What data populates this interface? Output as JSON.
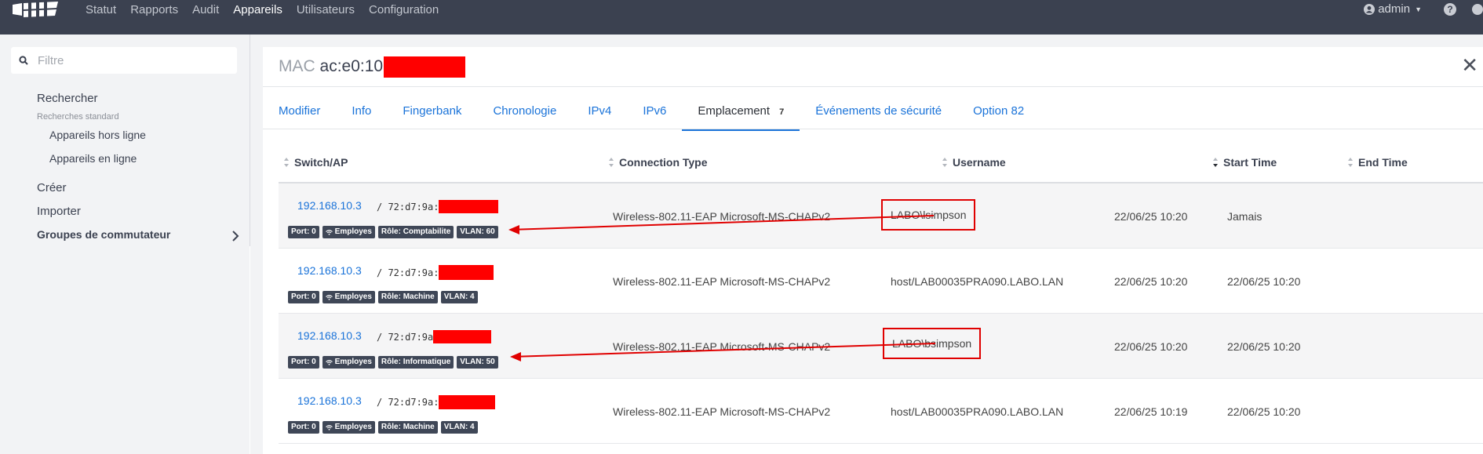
{
  "nav": {
    "items": [
      "Statut",
      "Rapports",
      "Audit",
      "Appareils",
      "Utilisateurs",
      "Configuration"
    ],
    "active": "Appareils",
    "user": "admin"
  },
  "sidebar": {
    "filter_placeholder": "Filtre",
    "search_label": "Rechercher",
    "standard_searches_label": "Recherches standard",
    "offline_devices": "Appareils hors ligne",
    "online_devices": "Appareils en ligne",
    "create": "Créer",
    "import": "Importer",
    "switch_groups": "Groupes de commutateur"
  },
  "panel": {
    "mac_label": "MAC",
    "mac_value": "ac:e0:10"
  },
  "tabs": [
    {
      "label": "Modifier"
    },
    {
      "label": "Info"
    },
    {
      "label": "Fingerbank"
    },
    {
      "label": "Chronologie"
    },
    {
      "label": "IPv4"
    },
    {
      "label": "IPv6"
    },
    {
      "label": "Emplacement",
      "count": "7",
      "active": true
    },
    {
      "label": "Événements de sécurité"
    },
    {
      "label": "Option 82"
    }
  ],
  "table": {
    "headers": [
      "Switch/AP",
      "Connection Type",
      "Username",
      "Start Time",
      "End Time"
    ],
    "rows": [
      {
        "ip": "192.168.10.3",
        "mac": "/ 72:d7:9a:",
        "port": "Port: 0",
        "ssid": "Employes",
        "role": "Rôle: Comptabilite",
        "vlan": "VLAN: 60",
        "conn": "Wireless-802.11-EAP Microsoft-MS-CHAPv2",
        "user": "LABO\\lsimpson",
        "start": "22/06/25 10:20",
        "end": "Jamais"
      },
      {
        "ip": "192.168.10.3",
        "mac": "/ 72:d7:9a:",
        "port": "Port: 0",
        "ssid": "Employes",
        "role": "Rôle: Machine",
        "vlan": "VLAN: 4",
        "conn": "Wireless-802.11-EAP Microsoft-MS-CHAPv2",
        "user": "host/LAB00035PRA090.LABO.LAN",
        "start": "22/06/25 10:20",
        "end": "22/06/25 10:20"
      },
      {
        "ip": "192.168.10.3",
        "mac": "/ 72:d7:9a",
        "port": "Port: 0",
        "ssid": "Employes",
        "role": "Rôle: Informatique",
        "vlan": "VLAN: 50",
        "conn": "Wireless-802.11-EAP Microsoft-MS-CHAPv2",
        "user": "LABO\\bsimpson",
        "start": "22/06/25 10:20",
        "end": "22/06/25 10:20"
      },
      {
        "ip": "192.168.10.3",
        "mac": "/ 72:d7:9a:",
        "port": "Port: 0",
        "ssid": "Employes",
        "role": "Rôle: Machine",
        "vlan": "VLAN: 4",
        "conn": "Wireless-802.11-EAP Microsoft-MS-CHAPv2",
        "user": "host/LAB00035PRA090.LABO.LAN",
        "start": "22/06/25 10:19",
        "end": "22/06/25 10:20"
      }
    ]
  },
  "colors": {
    "accent": "#1a73d9",
    "nav_bg": "#3b4150",
    "annotation": "#e00000"
  }
}
